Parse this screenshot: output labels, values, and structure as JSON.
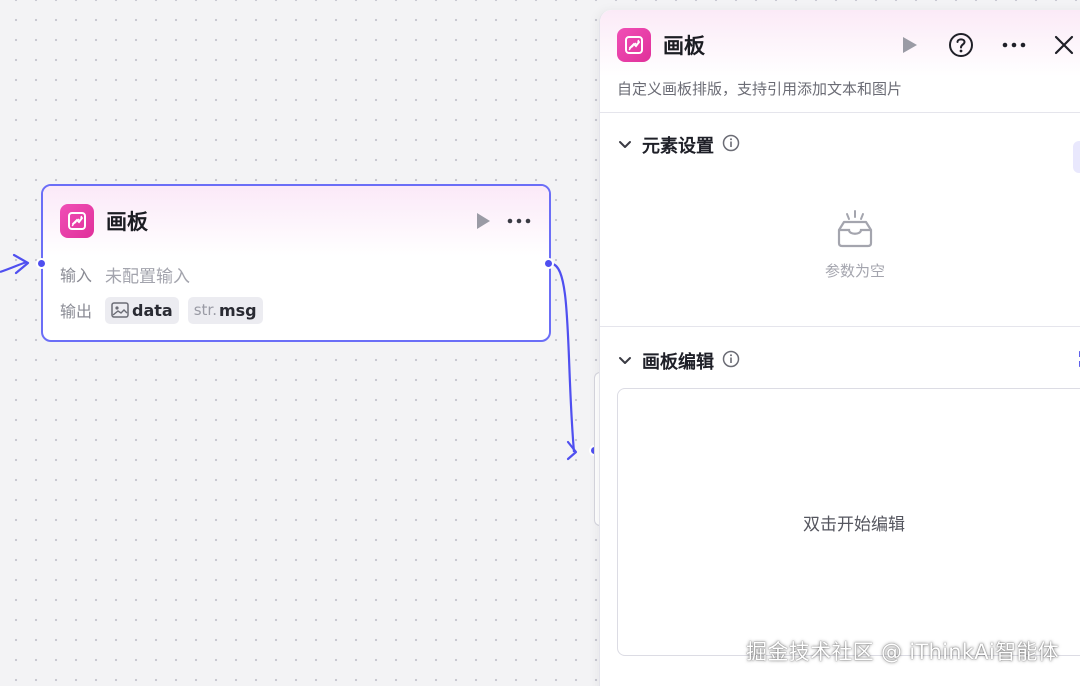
{
  "canvas_node": {
    "title": "画板",
    "input_label": "输入",
    "input_value": "未配置输入",
    "output_label": "输出",
    "outputs": [
      {
        "type_label": "",
        "icon": "image-icon",
        "name": "data"
      },
      {
        "type_label": "str.",
        "icon": "",
        "name": "msg"
      }
    ]
  },
  "panel": {
    "title": "画板",
    "description": "自定义画板排版，支持引用添加文本和图片",
    "element_settings": {
      "title": "元素设置",
      "add_label": "+",
      "empty_text": "参数为空"
    },
    "canvas_edit": {
      "title": "画板编辑",
      "hint": "双击开始编辑"
    }
  },
  "watermark": "掘金技术社区 @ iThinkAi智能体",
  "colors": {
    "accent": "#4f4ff0",
    "node_border": "#6b6ef7",
    "app_icon": "#e83fa8"
  }
}
